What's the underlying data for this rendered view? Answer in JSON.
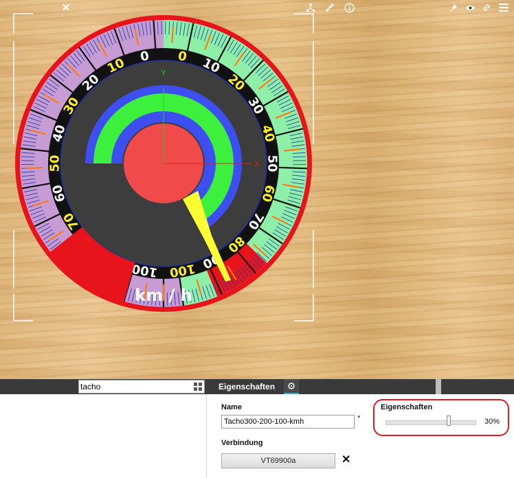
{
  "scene": {
    "gauge_unit": "km / h",
    "outer_labels": [
      "0",
      "10",
      "20",
      "30",
      "40",
      "50",
      "60",
      "70",
      "80",
      "90",
      "100"
    ],
    "inner_labels": [
      "0",
      "10",
      "20",
      "30",
      "40",
      "50",
      "60",
      "70",
      "80",
      "90",
      "100"
    ],
    "axis_y_label": "Y",
    "axis_x_label": "X",
    "colors": {
      "rim": "#e8141b",
      "face": "#3d3d3d",
      "green": "#3ef03e",
      "blue": "#3d4ff0",
      "red": "#f04a4a",
      "needle": "#ffff33",
      "purple": "#c79bd4",
      "mint": "#8ef0a8"
    }
  },
  "panel": {
    "search": {
      "value": "tacho"
    },
    "tab_label": "Eigenschaften",
    "name_label": "Name",
    "name_value": "Tacho300-200-100-kmh",
    "name_modified_marker": "*",
    "connection_label": "Verbindung",
    "connection_button": "VT69900a",
    "props_label": "Eigenschaften",
    "opacity_value": 0.3,
    "opacity_text": "30%"
  },
  "icons": {
    "close": "close-icon",
    "grid": "grid-view-icon",
    "gear": "gear-icon",
    "hierarchy": "hierarchy-icon",
    "brush": "brush-icon",
    "info": "info-icon",
    "pin": "pin-icon",
    "eye": "eye-icon",
    "link": "link-icon",
    "menu": "menu-icon"
  }
}
